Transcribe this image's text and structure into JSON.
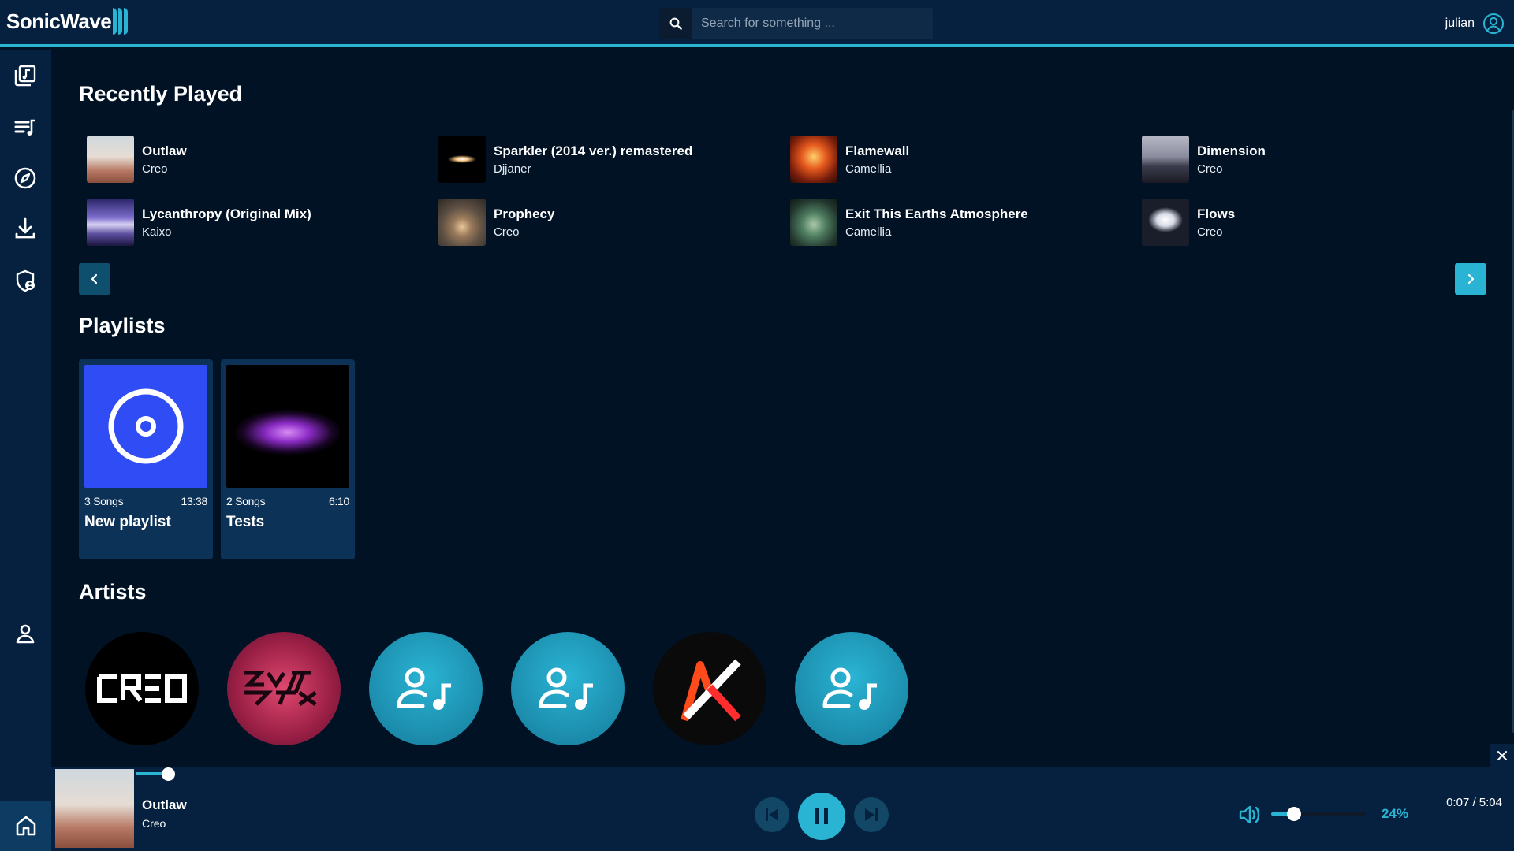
{
  "app": {
    "name": "SonicWave"
  },
  "search": {
    "placeholder": "Search for something ..."
  },
  "user": {
    "name": "julian"
  },
  "sidebar": {
    "items": [
      {
        "name": "library"
      },
      {
        "name": "queue"
      },
      {
        "name": "discover"
      },
      {
        "name": "downloads"
      },
      {
        "name": "admin"
      },
      {
        "name": "profile"
      },
      {
        "name": "home"
      }
    ]
  },
  "recently_played": {
    "title": "Recently Played",
    "tracks": [
      {
        "title": "Outlaw",
        "artist": "Creo"
      },
      {
        "title": "Sparkler (2014 ver.) remastered",
        "artist": "Djjaner"
      },
      {
        "title": "Flamewall",
        "artist": "Camellia"
      },
      {
        "title": "Dimension",
        "artist": "Creo"
      },
      {
        "title": "Lycanthropy (Original Mix)",
        "artist": "Kaixo"
      },
      {
        "title": "Prophecy",
        "artist": "Creo"
      },
      {
        "title": "Exit This Earths Atmosphere",
        "artist": "Camellia"
      },
      {
        "title": "Flows",
        "artist": "Creo"
      }
    ]
  },
  "playlists": {
    "title": "Playlists",
    "items": [
      {
        "title": "New playlist",
        "songs": "3 Songs",
        "duration": "13:38"
      },
      {
        "title": "Tests",
        "songs": "2 Songs",
        "duration": "6:10"
      }
    ]
  },
  "artists": {
    "title": "Artists",
    "items": [
      {
        "icon": "creo-logo"
      },
      {
        "icon": "camellia-logo"
      },
      {
        "icon": "artist-placeholder-icon"
      },
      {
        "icon": "artist-placeholder-icon"
      },
      {
        "icon": "kaixo-logo"
      },
      {
        "icon": "artist-placeholder-icon"
      }
    ]
  },
  "player": {
    "title": "Outlaw",
    "artist": "Creo",
    "time": "0:07 / 5:04",
    "progress_fraction": 0.023,
    "volume_label": "24%",
    "volume": 0.24,
    "state": "playing"
  },
  "colors": {
    "accent": "#2ab4d4",
    "background": "#011225",
    "panel": "#05213f",
    "card": "#0d3257"
  }
}
